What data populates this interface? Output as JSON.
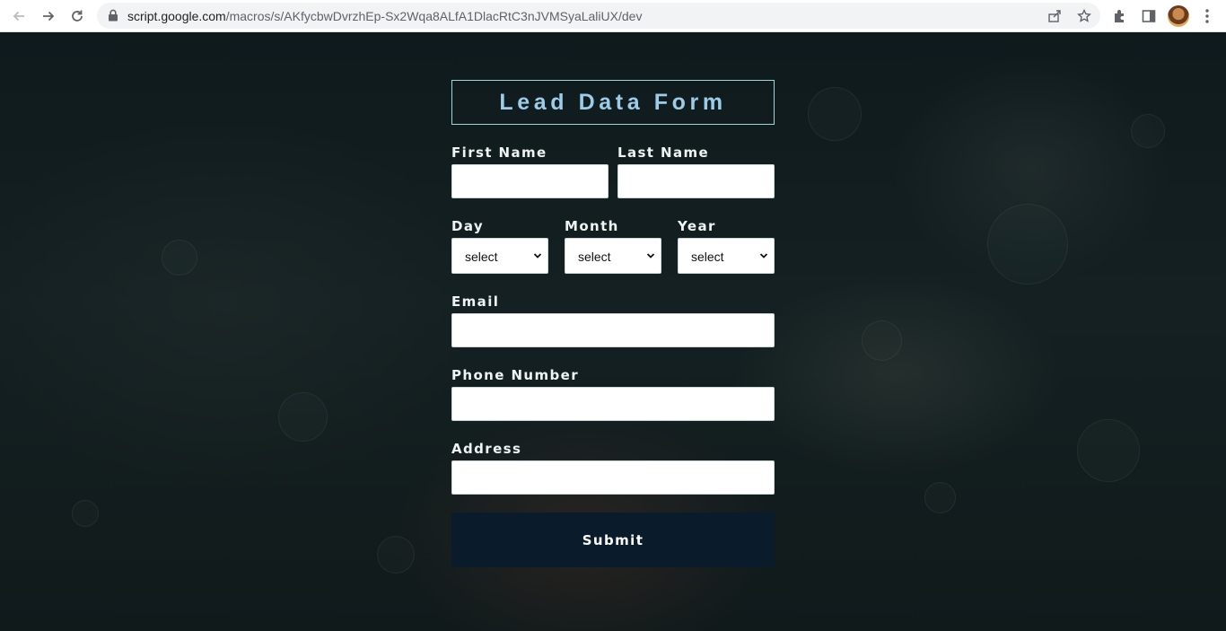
{
  "browser": {
    "url_host": "script.google.com",
    "url_path": "/macros/s/AKfycbwDvrzhEp-Sx2Wqa8ALfA1DlacRtC3nJVMSyaLaliUX/dev",
    "icons": [
      "back-icon",
      "forward-icon",
      "reload-icon",
      "lock-icon",
      "share-icon",
      "star-icon",
      "extensions-icon",
      "side-panel-icon",
      "profile-avatar",
      "menu-icon"
    ]
  },
  "form": {
    "title": "Lead Data Form",
    "first_name_label": "First Name",
    "last_name_label": "Last Name",
    "day_label": "Day",
    "month_label": "Month",
    "year_label": "Year",
    "day_value": "select",
    "month_value": "select",
    "year_value": "select",
    "email_label": "Email",
    "phone_label": "Phone Number",
    "address_label": "Address",
    "submit_label": "Submit"
  },
  "colors": {
    "title_text": "#9ccde8",
    "title_border": "#9fd6d8",
    "submit_bg": "#0a1c2b",
    "page_bg": "#0f1a1d"
  }
}
